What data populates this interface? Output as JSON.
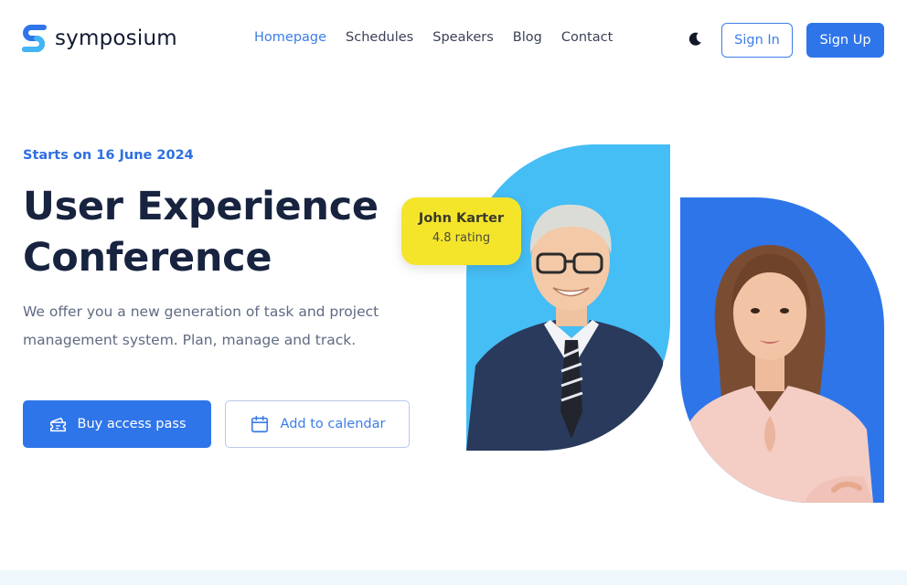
{
  "brand": {
    "name": "symposium",
    "accent": "#2f75ea",
    "yellow": "#f4e52b",
    "sky": "#45bdf5"
  },
  "nav": {
    "items": [
      {
        "label": "Homepage",
        "active": true
      },
      {
        "label": "Schedules",
        "active": false
      },
      {
        "label": "Speakers",
        "active": false
      },
      {
        "label": "Blog",
        "active": false
      },
      {
        "label": "Contact",
        "active": false
      }
    ]
  },
  "header": {
    "theme_icon": "moon-icon",
    "signin_label": "Sign In",
    "signup_label": "Sign Up"
  },
  "hero": {
    "date_label": "Starts on 16 June 2024",
    "title_line1": "User Experience",
    "title_line2": "Conference",
    "desc_line1": "We offer you a new generation of task and project",
    "desc_line2": "management system. Plan, manage and track.",
    "buy_label": "Buy access pass",
    "buy_icon": "ticket-icon",
    "calendar_label": "Add to calendar",
    "calendar_icon": "calendar-icon"
  },
  "speaker_badge": {
    "name": "John Karter",
    "rating": "4.8 rating"
  }
}
